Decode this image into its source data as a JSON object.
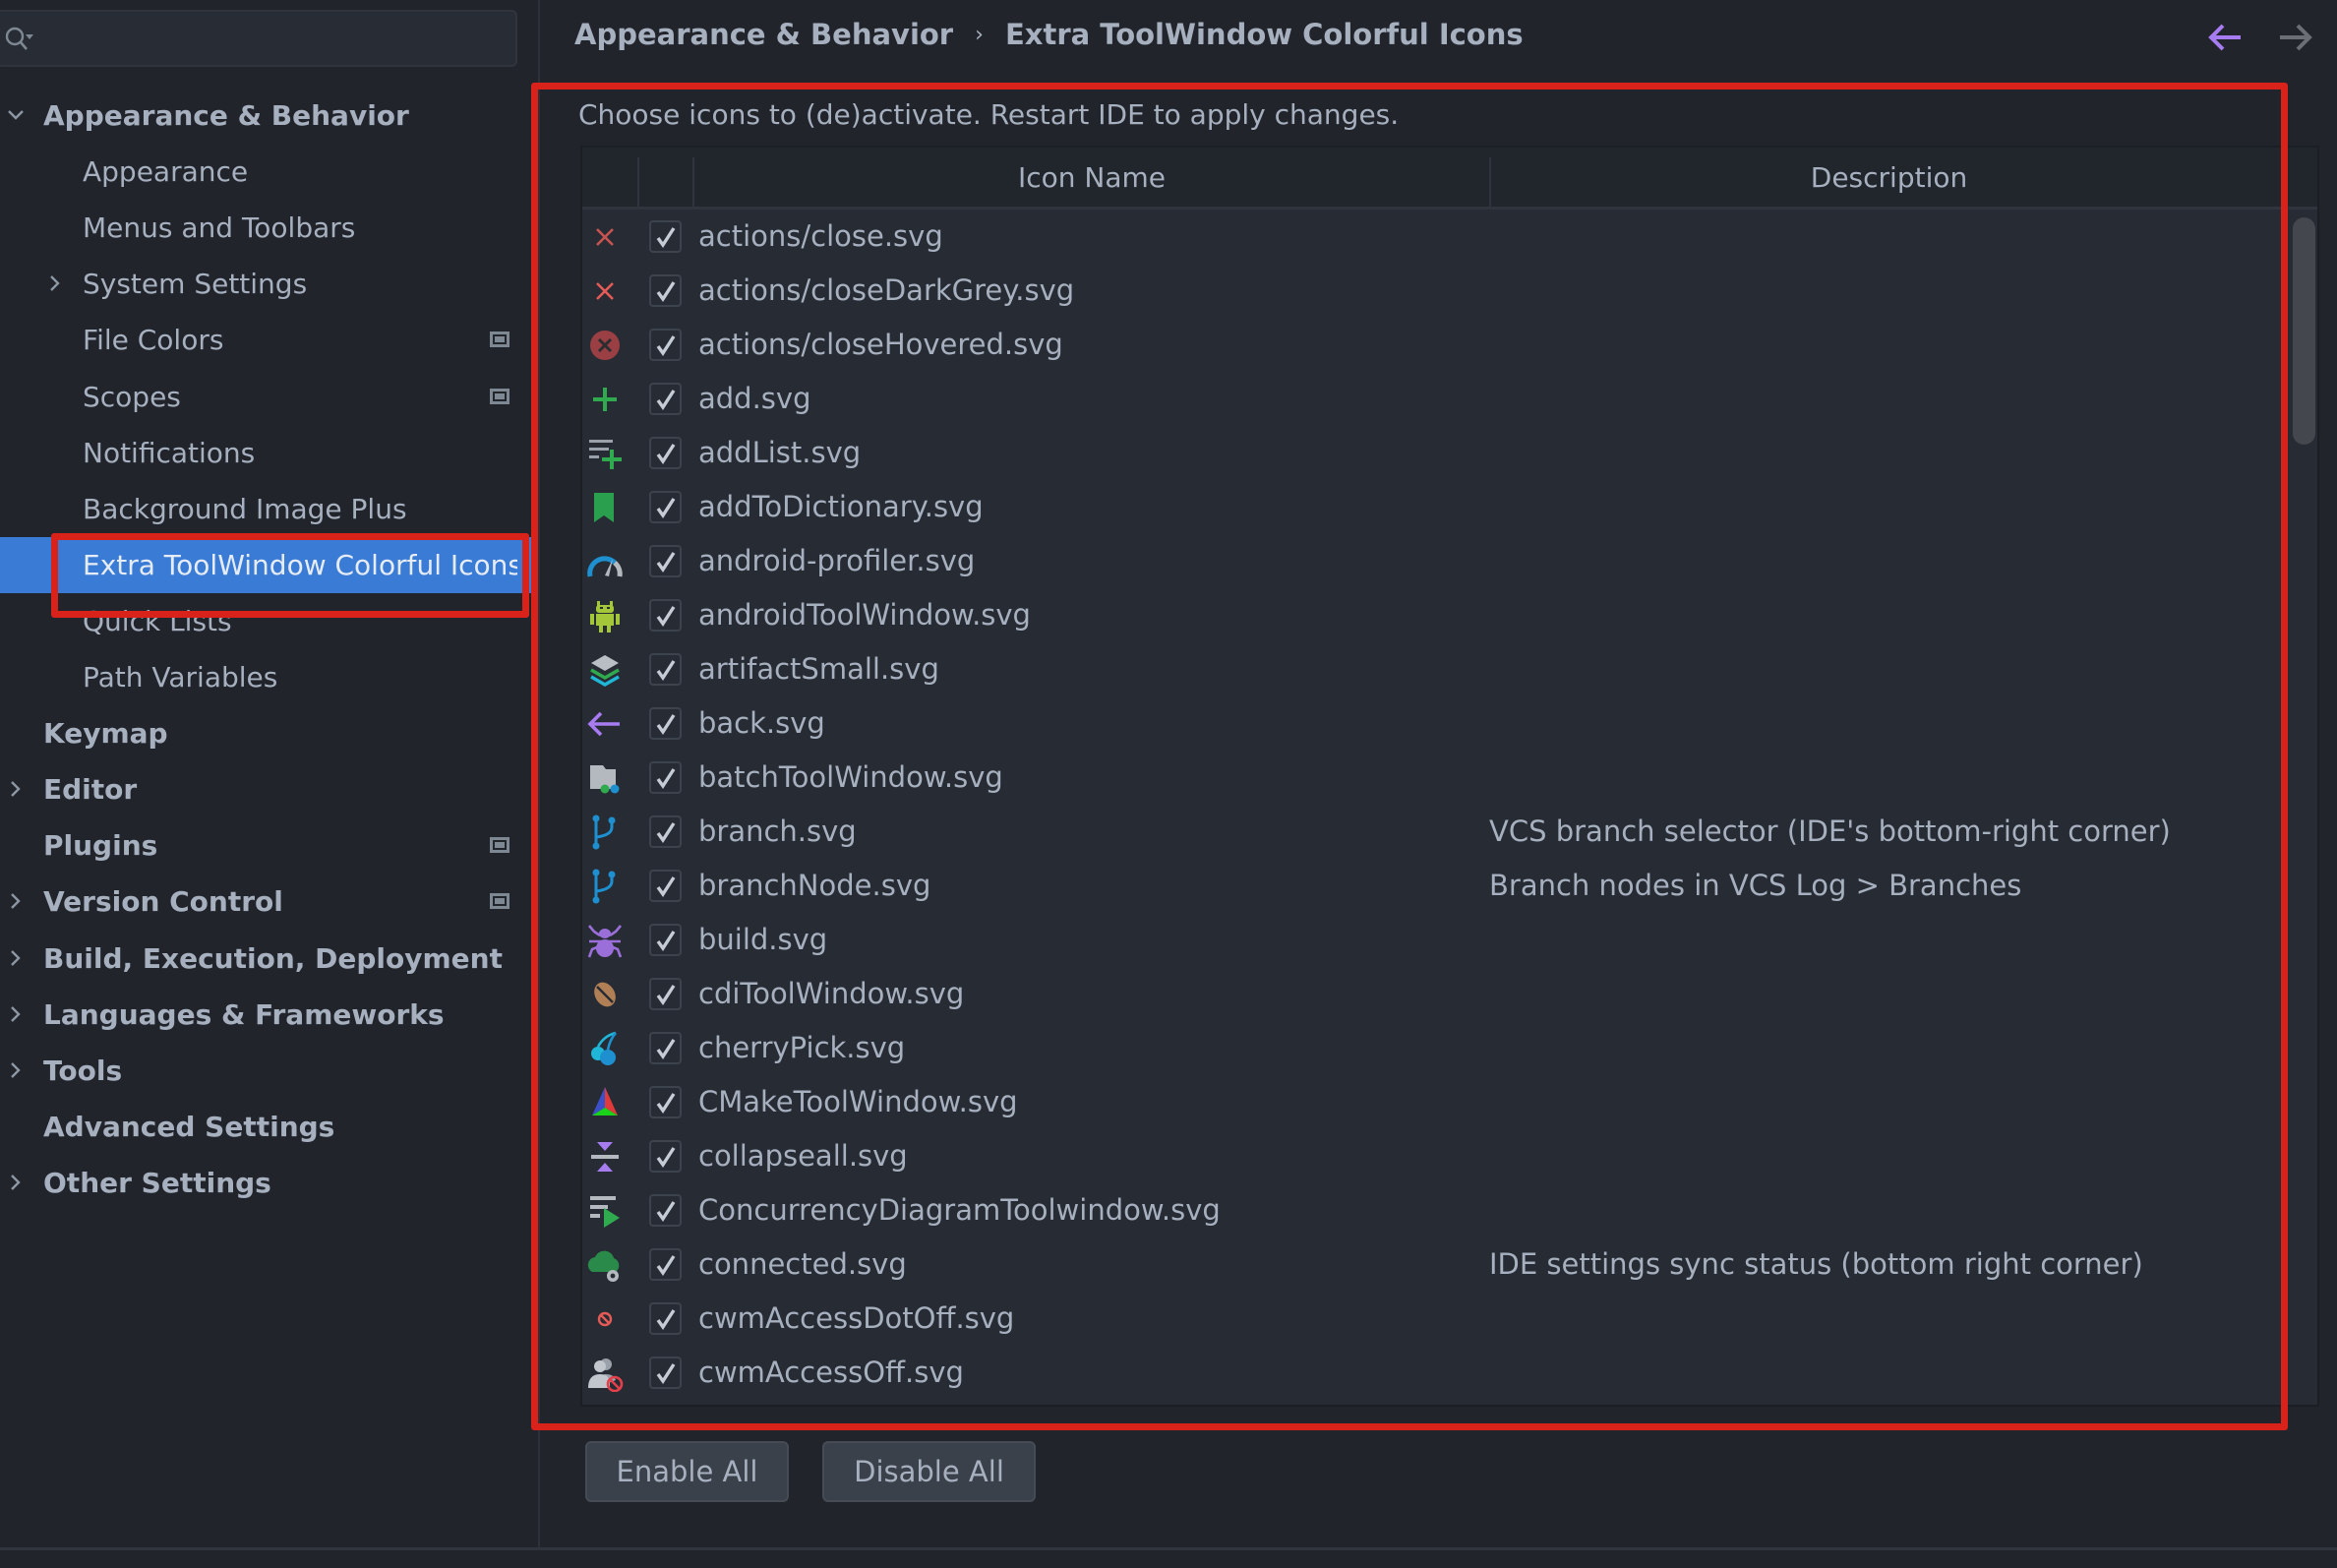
{
  "search": {
    "placeholder": "",
    "value": ""
  },
  "sidebar": {
    "items": [
      {
        "label": "Appearance & Behavior",
        "level": 0,
        "bold": true,
        "chevron": "down",
        "project_icon": false
      },
      {
        "label": "Appearance",
        "level": 1,
        "bold": false,
        "chevron": "",
        "project_icon": false
      },
      {
        "label": "Menus and Toolbars",
        "level": 1,
        "bold": false,
        "chevron": "",
        "project_icon": false
      },
      {
        "label": "System Settings",
        "level": 1,
        "bold": false,
        "chevron": "right",
        "project_icon": false
      },
      {
        "label": "File Colors",
        "level": 1,
        "bold": false,
        "chevron": "",
        "project_icon": true
      },
      {
        "label": "Scopes",
        "level": 1,
        "bold": false,
        "chevron": "",
        "project_icon": true
      },
      {
        "label": "Notifications",
        "level": 1,
        "bold": false,
        "chevron": "",
        "project_icon": false
      },
      {
        "label": "Background Image Plus",
        "level": 1,
        "bold": false,
        "chevron": "",
        "project_icon": false
      },
      {
        "label": "Extra ToolWindow Colorful Icons",
        "level": 1,
        "bold": false,
        "chevron": "",
        "project_icon": false,
        "selected": true
      },
      {
        "label": "Quick Lists",
        "level": 1,
        "bold": false,
        "chevron": "",
        "project_icon": false
      },
      {
        "label": "Path Variables",
        "level": 1,
        "bold": false,
        "chevron": "",
        "project_icon": false
      },
      {
        "label": "Keymap",
        "level": 0,
        "bold": true,
        "chevron": "",
        "project_icon": false
      },
      {
        "label": "Editor",
        "level": 0,
        "bold": true,
        "chevron": "right",
        "project_icon": false
      },
      {
        "label": "Plugins",
        "level": 0,
        "bold": true,
        "chevron": "",
        "project_icon": true
      },
      {
        "label": "Version Control",
        "level": 0,
        "bold": true,
        "chevron": "right",
        "project_icon": true
      },
      {
        "label": "Build, Execution, Deployment",
        "level": 0,
        "bold": true,
        "chevron": "right",
        "project_icon": false
      },
      {
        "label": "Languages & Frameworks",
        "level": 0,
        "bold": true,
        "chevron": "right",
        "project_icon": false
      },
      {
        "label": "Tools",
        "level": 0,
        "bold": true,
        "chevron": "right",
        "project_icon": false
      },
      {
        "label": "Advanced Settings",
        "level": 0,
        "bold": true,
        "chevron": "",
        "project_icon": false
      },
      {
        "label": "Other Settings",
        "level": 0,
        "bold": true,
        "chevron": "right",
        "project_icon": false
      }
    ]
  },
  "breadcrumb": {
    "parent": "Appearance & Behavior",
    "separator": "›",
    "current": "Extra ToolWindow Colorful Icons"
  },
  "nav": {
    "back_icon": "arrow-left-icon",
    "forward_icon": "arrow-right-icon",
    "back_color": "#a77cf0",
    "forward_color": "#6b6f75"
  },
  "panel": {
    "description": "Choose icons to (de)activate. Restart IDE to apply changes.",
    "table": {
      "columns": [
        "",
        "",
        "Icon Name",
        "Description"
      ],
      "rows": [
        {
          "icon": "close-icon",
          "checked": true,
          "name": "actions/close.svg",
          "description": ""
        },
        {
          "icon": "close-dark-grey-icon",
          "checked": true,
          "name": "actions/closeDarkGrey.svg",
          "description": ""
        },
        {
          "icon": "close-hovered-icon",
          "checked": true,
          "name": "actions/closeHovered.svg",
          "description": ""
        },
        {
          "icon": "add-icon",
          "checked": true,
          "name": "add.svg",
          "description": ""
        },
        {
          "icon": "add-list-icon",
          "checked": true,
          "name": "addList.svg",
          "description": ""
        },
        {
          "icon": "bookmark-icon",
          "checked": true,
          "name": "addToDictionary.svg",
          "description": ""
        },
        {
          "icon": "gauge-icon",
          "checked": true,
          "name": "android-profiler.svg",
          "description": ""
        },
        {
          "icon": "android-icon",
          "checked": true,
          "name": "androidToolWindow.svg",
          "description": ""
        },
        {
          "icon": "layers-icon",
          "checked": true,
          "name": "artifactSmall.svg",
          "description": ""
        },
        {
          "icon": "back-arrow-icon",
          "checked": true,
          "name": "back.svg",
          "description": ""
        },
        {
          "icon": "batch-folder-icon",
          "checked": true,
          "name": "batchToolWindow.svg",
          "description": ""
        },
        {
          "icon": "branch-icon",
          "checked": true,
          "name": "branch.svg",
          "description": "VCS branch selector (IDE's bottom-right corner)"
        },
        {
          "icon": "branch-node-icon",
          "checked": true,
          "name": "branchNode.svg",
          "description": "Branch nodes in VCS Log > Branches"
        },
        {
          "icon": "bug-icon",
          "checked": true,
          "name": "build.svg",
          "description": ""
        },
        {
          "icon": "bean-icon",
          "checked": true,
          "name": "cdiToolWindow.svg",
          "description": ""
        },
        {
          "icon": "cherry-icon",
          "checked": true,
          "name": "cherryPick.svg",
          "description": ""
        },
        {
          "icon": "cmake-icon",
          "checked": true,
          "name": "CMakeToolWindow.svg",
          "description": ""
        },
        {
          "icon": "collapse-all-icon",
          "checked": true,
          "name": "collapseall.svg",
          "description": ""
        },
        {
          "icon": "concurrency-diagram-icon",
          "checked": true,
          "name": "ConcurrencyDiagramToolwindow.svg",
          "description": ""
        },
        {
          "icon": "cloud-gear-icon",
          "checked": true,
          "name": "connected.svg",
          "description": "IDE settings sync status (bottom right corner)"
        },
        {
          "icon": "no-entry-dot-icon",
          "checked": true,
          "name": "cwmAccessDotOff.svg",
          "description": ""
        },
        {
          "icon": "users-off-icon",
          "checked": true,
          "name": "cwmAccessOff.svg",
          "description": ""
        }
      ]
    },
    "buttons": {
      "enable_all": "Enable All",
      "disable_all": "Disable All"
    }
  },
  "colors": {
    "selection": "#3a7bd5",
    "annotation_red": "#d9221a",
    "background": "#21242b",
    "table_background": "#272b33"
  }
}
